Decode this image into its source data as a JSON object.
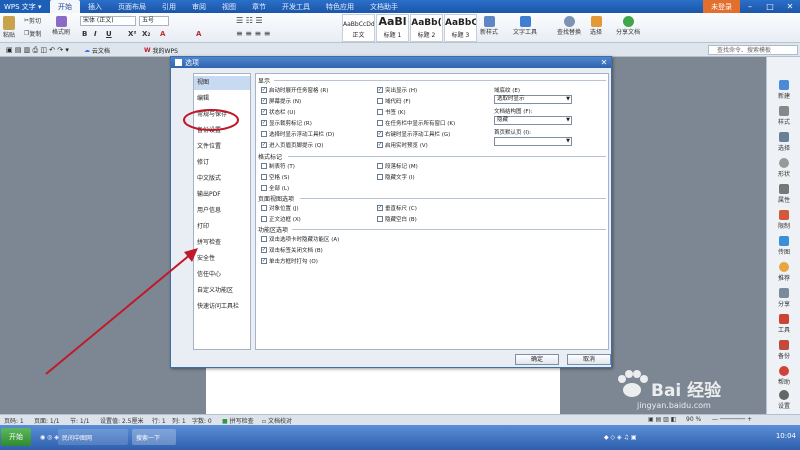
{
  "app": {
    "menu_label": "WPS 文字 ▾",
    "login": "未登录"
  },
  "menu_tabs": [
    "开始",
    "插入",
    "页面布局",
    "引用",
    "审阅",
    "视图",
    "章节",
    "开发工具",
    "特色应用",
    "文档助手"
  ],
  "ribbon": {
    "paste": "粘贴",
    "cut": "剪切",
    "copy": "复制",
    "format_painter": "格式刷",
    "font_name": "宋体 (正文)",
    "font_size": "五号",
    "styles": [
      {
        "sample": "AaBbCcDd",
        "label": "正文"
      },
      {
        "sample": "AaBl",
        "label": "标题 1"
      },
      {
        "sample": "AaBb(",
        "label": "标题 2"
      },
      {
        "sample": "AaBbC",
        "label": "标题 3"
      }
    ],
    "new_style": "新样式",
    "text_tools": "文字工具",
    "find_replace": "查找替换",
    "select": "选择",
    "share": "分享文档"
  },
  "tabsbar": {
    "cloud_doc": "云文档",
    "my_wps": "我的WPS",
    "search_placeholder": "查找命令、搜索模板"
  },
  "dialog": {
    "title": "选项",
    "nav": [
      "视图",
      "编辑",
      "常规与保存",
      "备份设置",
      "文件位置",
      "修订",
      "中文版式",
      "输出PDF",
      "用户信息",
      "打印",
      "拼写检查",
      "安全性",
      "信任中心",
      "自定义功能区",
      "快速访问工具栏"
    ],
    "selected_nav": 0,
    "sections": {
      "display": "显示",
      "format_marks": "格式标记",
      "page_view": "页面视图选项",
      "ribbon_opts": "功能区选项"
    },
    "display_left": [
      {
        "label": "启动时展开任务窗格 (R)",
        "checked": true
      },
      {
        "label": "屏幕提示 (N)",
        "checked": true
      },
      {
        "label": "状态栏 (U)",
        "checked": true
      },
      {
        "label": "显示裁剪标记 (R)",
        "checked": true
      },
      {
        "label": "选择时显示浮动工具栏 (D)",
        "checked": false
      },
      {
        "label": "进入页眉页脚提示 (Q)",
        "checked": true
      }
    ],
    "display_mid": [
      {
        "label": "突出显示 (H)",
        "checked": true
      },
      {
        "label": "域代码 (F)",
        "checked": false
      },
      {
        "label": "书签 (K)",
        "checked": false
      },
      {
        "label": "在任务栏中显示所有窗口 (K)",
        "checked": false
      },
      {
        "label": "右键时显示浮动工具栏 (G)",
        "checked": true
      },
      {
        "label": "启用实时预览 (V)",
        "checked": true
      }
    ],
    "field_shading_label": "域底纹 (E)",
    "field_shading_value": "选取时显示",
    "doc_map_label": "文档结构图 (F):",
    "doc_map_value": "隐藏",
    "first_page_label": "首页默认页 (I):",
    "first_page_value": "",
    "format_left": [
      {
        "label": "制表符 (T)",
        "checked": false
      },
      {
        "label": "空格 (S)",
        "checked": false
      },
      {
        "label": "全部 (L)",
        "checked": false
      }
    ],
    "format_mid": [
      {
        "label": "段落标记 (M)",
        "checked": false
      },
      {
        "label": "隐藏文字 (I)",
        "checked": false
      }
    ],
    "page_left": [
      {
        "label": "对象位置 (J)",
        "checked": false
      },
      {
        "label": "正文边框 (X)",
        "checked": false
      }
    ],
    "page_mid": [
      {
        "label": "垂直标尺 (C)",
        "checked": true
      },
      {
        "label": "隐藏空白 (B)",
        "checked": false
      }
    ],
    "ribbon_items": [
      {
        "label": "双击选项卡时隐藏功能区 (A)",
        "checked": false
      },
      {
        "label": "双击标签关闭文档 (B)",
        "checked": true
      },
      {
        "label": "单击方框时打勾 (O)",
        "checked": true
      }
    ],
    "ok": "确定",
    "cancel": "取消"
  },
  "rightbar": [
    "新建",
    "样式",
    "选择",
    "形状",
    "属性",
    "限制",
    "传图",
    "推荐",
    "分享",
    "工具",
    "备份",
    "帮助",
    "设置"
  ],
  "statusbar": {
    "page": "页码: 1",
    "pages": "页面: 1/1",
    "section": "节: 1/1",
    "settings": "设置值: 2.5厘米",
    "row": "行: 1",
    "col": "列: 1",
    "words": "字数: 0",
    "spell": "拼写检查",
    "doc_check": "文档校对",
    "zoom": "90 %"
  },
  "taskbar": {
    "start": "开始",
    "items": [
      "民间中图网",
      "搜索一下"
    ],
    "clock": "10:04"
  },
  "watermark": {
    "brand": "Bai 经验",
    "url": "jingyan.baidu.com"
  },
  "colors": {
    "title_blue": "#1b56a8",
    "annot_red": "#c0192a",
    "dialog_border": "#3d6ea8"
  }
}
